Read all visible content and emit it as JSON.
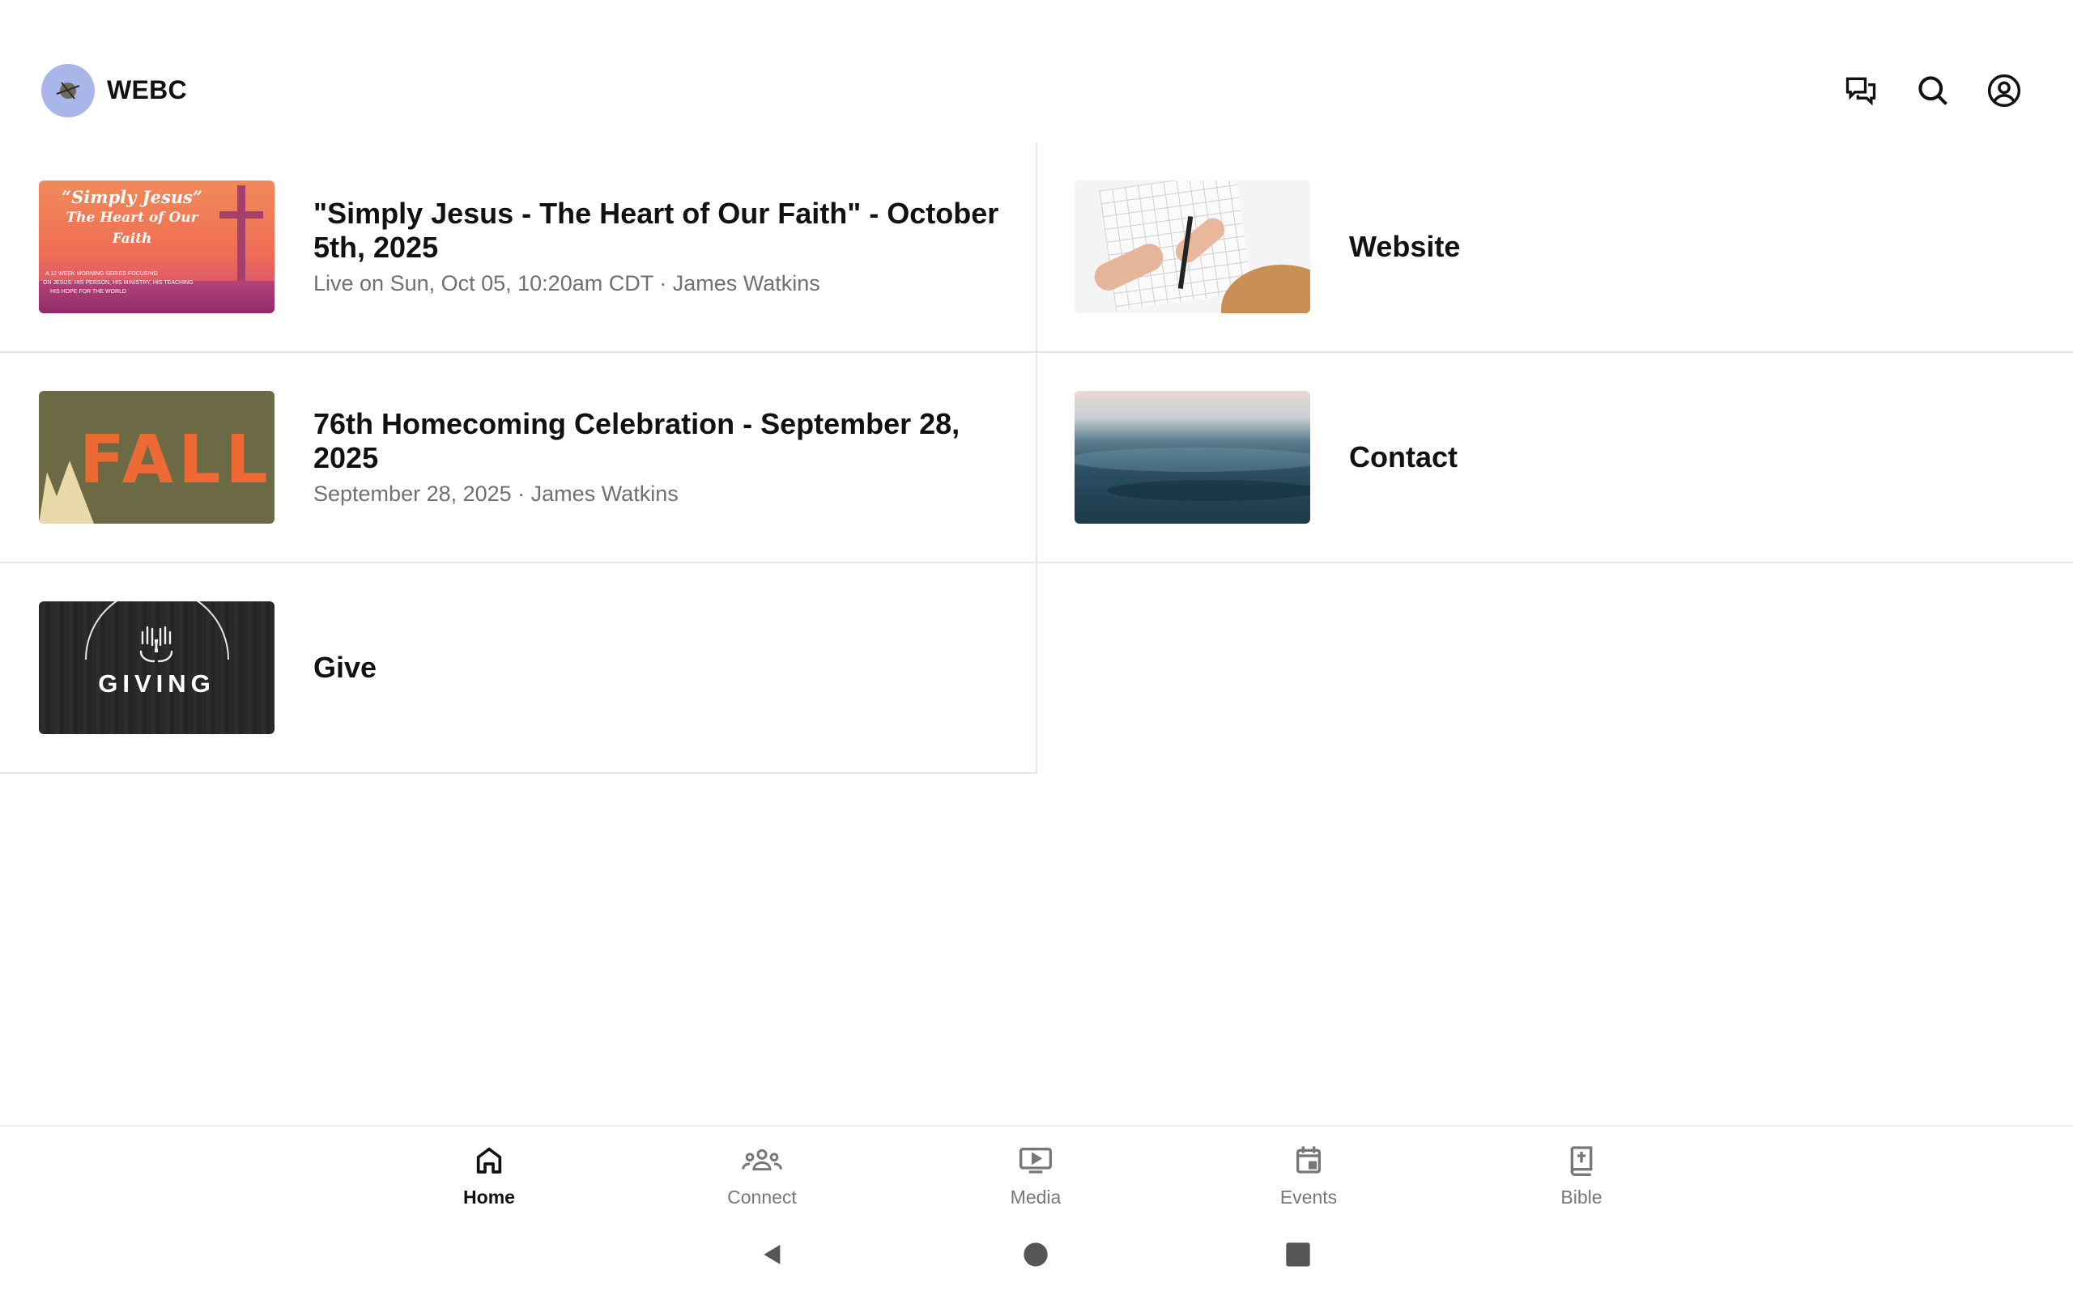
{
  "app": {
    "title": "WEBC"
  },
  "header": {
    "icons": [
      "chat-icon",
      "search-icon",
      "account-icon"
    ]
  },
  "tiles": [
    {
      "title": "\"Simply Jesus - The Heart of Our Faith\" - October 5th, 2025",
      "subtitle": "Live on Sun, Oct 05, 10:20am CDT · James Watkins",
      "thumb": {
        "line1": "“Simply Jesus”",
        "line2": "The Heart of Our",
        "line3": "Faith",
        "small1": "A 12 WEEK MORNING SERIES FOCUSING",
        "small2": "ON JESUS: HIS PERSON, HIS MINISTRY, HIS TEACHING",
        "small3": "HIS HOPE FOR THE WORLD"
      }
    },
    {
      "title": "Website"
    },
    {
      "title": "76th Homecoming Celebration - September 28, 2025",
      "subtitle": "September 28, 2025 · James Watkins",
      "thumb": {
        "word": "FALL"
      }
    },
    {
      "title": "Contact"
    },
    {
      "title": "Give",
      "thumb": {
        "word": "GIVING"
      }
    }
  ],
  "bottom_nav": [
    {
      "label": "Home",
      "icon": "home-icon",
      "active": true
    },
    {
      "label": "Connect",
      "icon": "people-icon"
    },
    {
      "label": "Media",
      "icon": "play-icon"
    },
    {
      "label": "Events",
      "icon": "calendar-icon"
    },
    {
      "label": "Bible",
      "icon": "bible-icon"
    }
  ],
  "colors": {
    "logo_bg": "#a9b6ea",
    "fall_bg": "#6b6a45",
    "fall_text": "#ee6a34",
    "giving_bg": "#2a2a2a"
  }
}
